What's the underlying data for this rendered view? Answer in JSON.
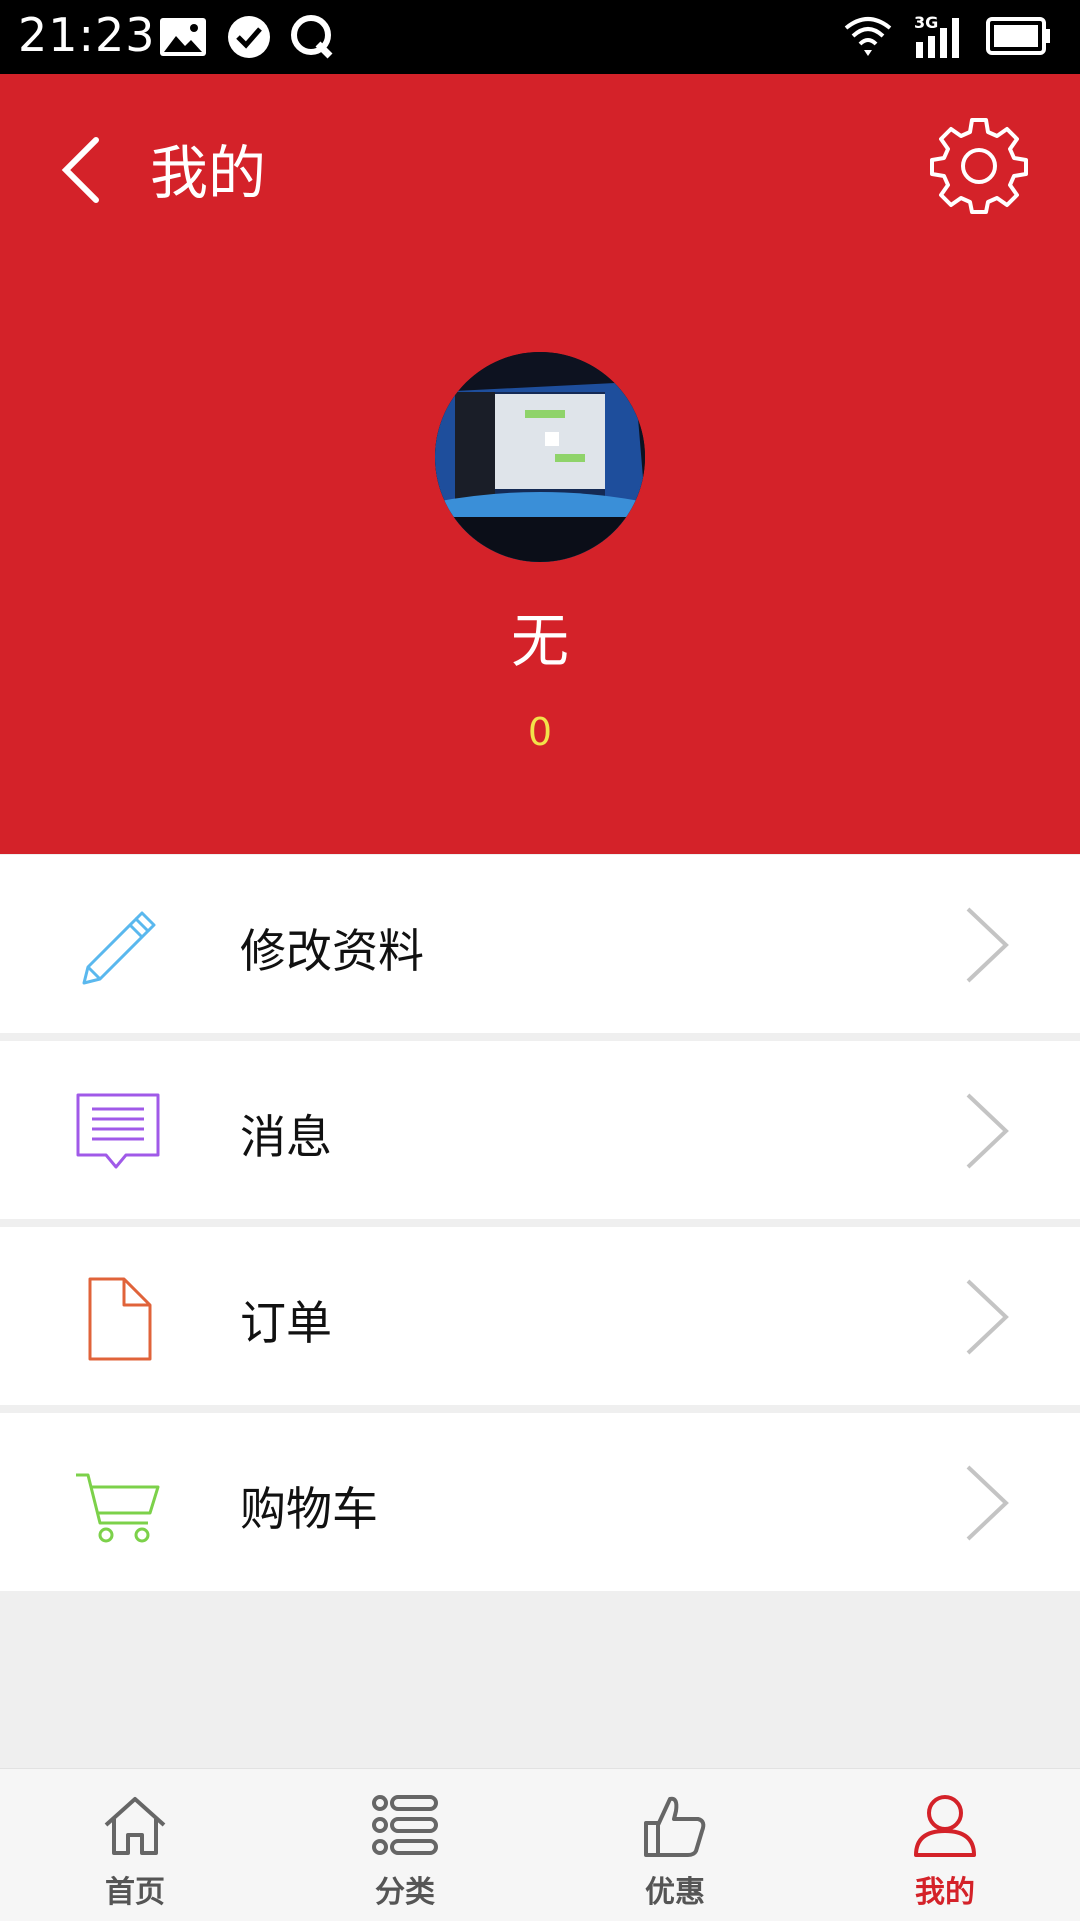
{
  "status_bar": {
    "time": "21:23",
    "left_icons": [
      "image-icon",
      "check-circle-icon",
      "q-icon"
    ],
    "right_icons": [
      "wifi-icon",
      "3g-signal-icon",
      "battery-icon"
    ],
    "network_type": "3G"
  },
  "header": {
    "title": "我的",
    "back_icon": "chevron-left-icon",
    "settings_icon": "gear-icon",
    "background_color": "#d42229",
    "username": "无",
    "points": "0"
  },
  "menu": {
    "items": [
      {
        "label": "修改资料",
        "icon": "pencil-icon",
        "icon_color": "#5ab8ee"
      },
      {
        "label": "消息",
        "icon": "message-icon",
        "icon_color": "#a05ae8"
      },
      {
        "label": "订单",
        "icon": "document-icon",
        "icon_color": "#e0633a"
      },
      {
        "label": "购物车",
        "icon": "cart-icon",
        "icon_color": "#7cd14a"
      }
    ]
  },
  "bottom_nav": {
    "tabs": [
      {
        "label": "首页",
        "icon": "home-icon",
        "active": false
      },
      {
        "label": "分类",
        "icon": "list-icon",
        "active": false
      },
      {
        "label": "优惠",
        "icon": "thumbs-up-icon",
        "active": false
      },
      {
        "label": "我的",
        "icon": "user-icon",
        "active": true
      }
    ],
    "active_color": "#d42229",
    "inactive_color": "#555555"
  }
}
